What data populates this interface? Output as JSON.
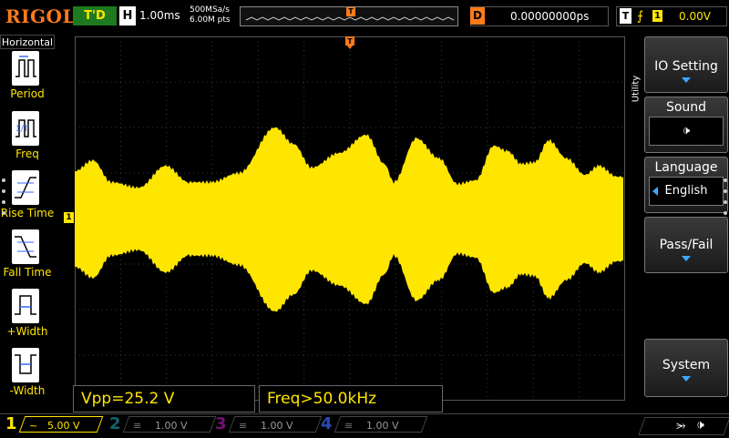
{
  "header": {
    "brand": "RIGOL",
    "run_status": "T'D",
    "horizontal_label": "H",
    "timebase": "1.00ms",
    "sample_rate": "500MSa/s",
    "memory_depth": "6.00M pts",
    "trigger_pos_marker": "T",
    "delay_label": "D",
    "delay_value": "0.00000000ps",
    "trigger_label": "T",
    "trigger_edge": "⨍",
    "trigger_source": "1",
    "trigger_level": "0.00V"
  },
  "left_menu": {
    "title": "Horizontal",
    "items": [
      {
        "label": "Period",
        "icon": "period-icon"
      },
      {
        "label": "Freq",
        "icon": "freq-icon"
      },
      {
        "label": "Rise Time",
        "icon": "rise-time-icon"
      },
      {
        "label": "Fall Time",
        "icon": "fall-time-icon"
      },
      {
        "label": "+Width",
        "icon": "pos-width-icon"
      },
      {
        "label": "-Width",
        "icon": "neg-width-icon"
      }
    ]
  },
  "right_menu": {
    "title": "Utility",
    "io_setting": "IO Setting",
    "sound": "Sound",
    "sound_icon": "speaker-icon",
    "language": "Language",
    "language_value": "English",
    "pass_fail": "Pass/Fail",
    "system": "System"
  },
  "channel_markers": {
    "ch1": "1"
  },
  "measurements": {
    "vpp": "Vpp=25.2 V",
    "freq": "Freq>50.0kHz"
  },
  "channels": [
    {
      "num": "1",
      "coupling": "~",
      "scale": "5.00 V",
      "color": "#ffe600"
    },
    {
      "num": "2",
      "coupling": "≡",
      "scale": "1.00 V",
      "color": "#1fb8c8"
    },
    {
      "num": "3",
      "coupling": "≡",
      "scale": "1.00 V",
      "color": "#d020d0"
    },
    {
      "num": "4",
      "coupling": "≡",
      "scale": "1.00 V",
      "color": "#3a6aff"
    }
  ],
  "status_icons": {
    "usb": "usb-icon",
    "speaker": "speaker-icon"
  },
  "colors": {
    "ch1": "#ffe600",
    "trigger": "#ff7a1a",
    "grid": "#3a3a3a",
    "accent_blue": "#3ea7ff"
  }
}
